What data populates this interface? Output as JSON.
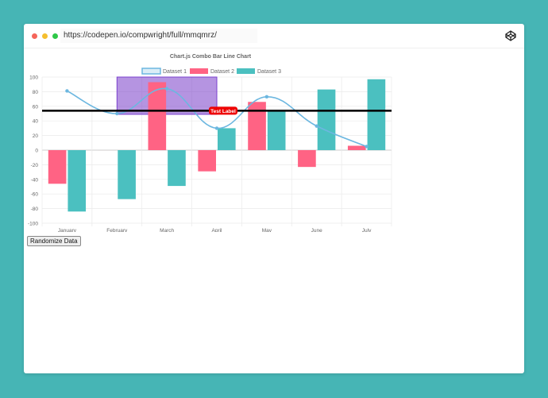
{
  "browser": {
    "url": "https://codepen.io/compwright/full/mmqmrz/"
  },
  "colors": {
    "background": "#46b5b5",
    "dataset1": "#6cb7e0",
    "dataset2": "#ff6384",
    "dataset3": "#4bc0c0",
    "box": "#9966cc",
    "label_bg": "#ee0000",
    "line": "#000000"
  },
  "controls": {
    "randomize_label": "Randomize Data"
  },
  "chart_data": {
    "type": "bar",
    "title": "Chart.js Combo Bar Line Chart",
    "xlabel": "",
    "ylabel": "",
    "categories": [
      "January",
      "February",
      "March",
      "April",
      "May",
      "June",
      "July"
    ],
    "ylim": [
      -100,
      100
    ],
    "yticks": [
      100,
      80,
      60,
      40,
      20,
      0,
      -20,
      -40,
      -60,
      -80,
      -100
    ],
    "grid": true,
    "legend": "top",
    "series": [
      {
        "name": "Dataset 1",
        "kind": "line",
        "values": [
          81,
          50,
          84,
          30,
          73,
          33,
          5
        ]
      },
      {
        "name": "Dataset 2",
        "kind": "bar",
        "values": [
          -46,
          0,
          93,
          -29,
          66,
          -23,
          6
        ]
      },
      {
        "name": "Dataset 3",
        "kind": "bar",
        "values": [
          -84,
          -67,
          -49,
          30,
          54,
          83,
          97
        ]
      }
    ],
    "annotations": {
      "horizontal_line": {
        "value": 54,
        "label": "Test Label"
      },
      "box": {
        "x_from": "February",
        "x_to": "April",
        "y_from": 49,
        "y_to": 100
      }
    }
  }
}
